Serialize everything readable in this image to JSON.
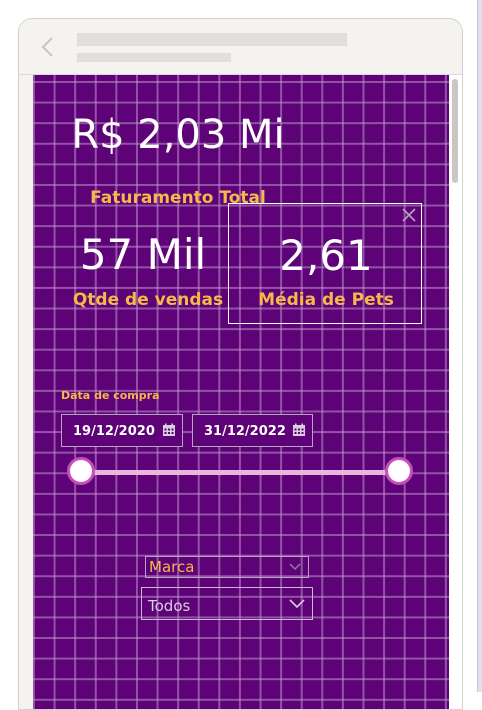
{
  "kpis": {
    "faturamento": {
      "value": "R$ 2,03 Mi",
      "label": "Faturamento Total"
    },
    "qtde_vendas": {
      "value": "57 Mil",
      "label": "Qtde de vendas"
    },
    "media_pets": {
      "value": "2,61",
      "label": "Média de Pets"
    }
  },
  "date_filter": {
    "title": "Data de compra",
    "start": "19/12/2020",
    "end": "31/12/2022",
    "range_start_fraction": 0.0,
    "range_end_fraction": 1.0
  },
  "brand_filter": {
    "title": "Marca",
    "selected": "Todos"
  },
  "icons": {
    "back": "chevron-left-icon",
    "close": "close-icon",
    "calendar": "calendar-icon",
    "dropdown": "chevron-down-icon"
  },
  "colors": {
    "background": "#5e0277",
    "grid": "#be96cd",
    "kpi_value": "#ffffff",
    "kpi_label": "#f5b94a",
    "slider_track": "#e8b6df",
    "slider_handle_border": "#c64fb8"
  }
}
